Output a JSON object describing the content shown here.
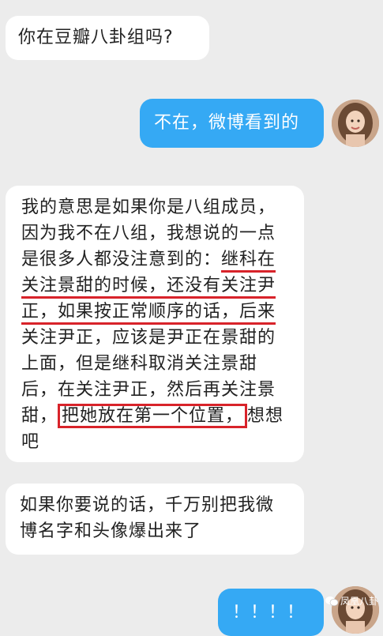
{
  "messages": [
    {
      "from": "other",
      "text": "你在豆瓣八卦组吗?"
    },
    {
      "from": "me",
      "text": "不在，微博看到的"
    },
    {
      "from": "other",
      "pre": "我的意思是如果你是八组成员，因为我不在八组，我想说的一点是很多人都没注意到的：",
      "u1": "继科在",
      "u2": "关注景甜的时候，还没有关注尹",
      "u3": "正，如果按正常顺序的话，后来",
      "mid": "关注尹正，应该是尹正在景甜的上面，但是继科取消关注景甜后，在关注尹正，然后再关注景甜，",
      "boxed": "把她放在第一个位置，",
      "post": "想想吧"
    },
    {
      "from": "other",
      "text": "如果你要说的话，千万别把我微博名字和头像爆出来了"
    },
    {
      "from": "me",
      "text": "！！！！"
    }
  ],
  "watermark": {
    "text": "凤凰八卦"
  },
  "colors": {
    "outgoing": "#35a9f4",
    "incoming": "#ffffff",
    "highlight": "#d8232a",
    "background": "#ececec"
  },
  "icons": [
    "avatar",
    "wechat-icon"
  ]
}
